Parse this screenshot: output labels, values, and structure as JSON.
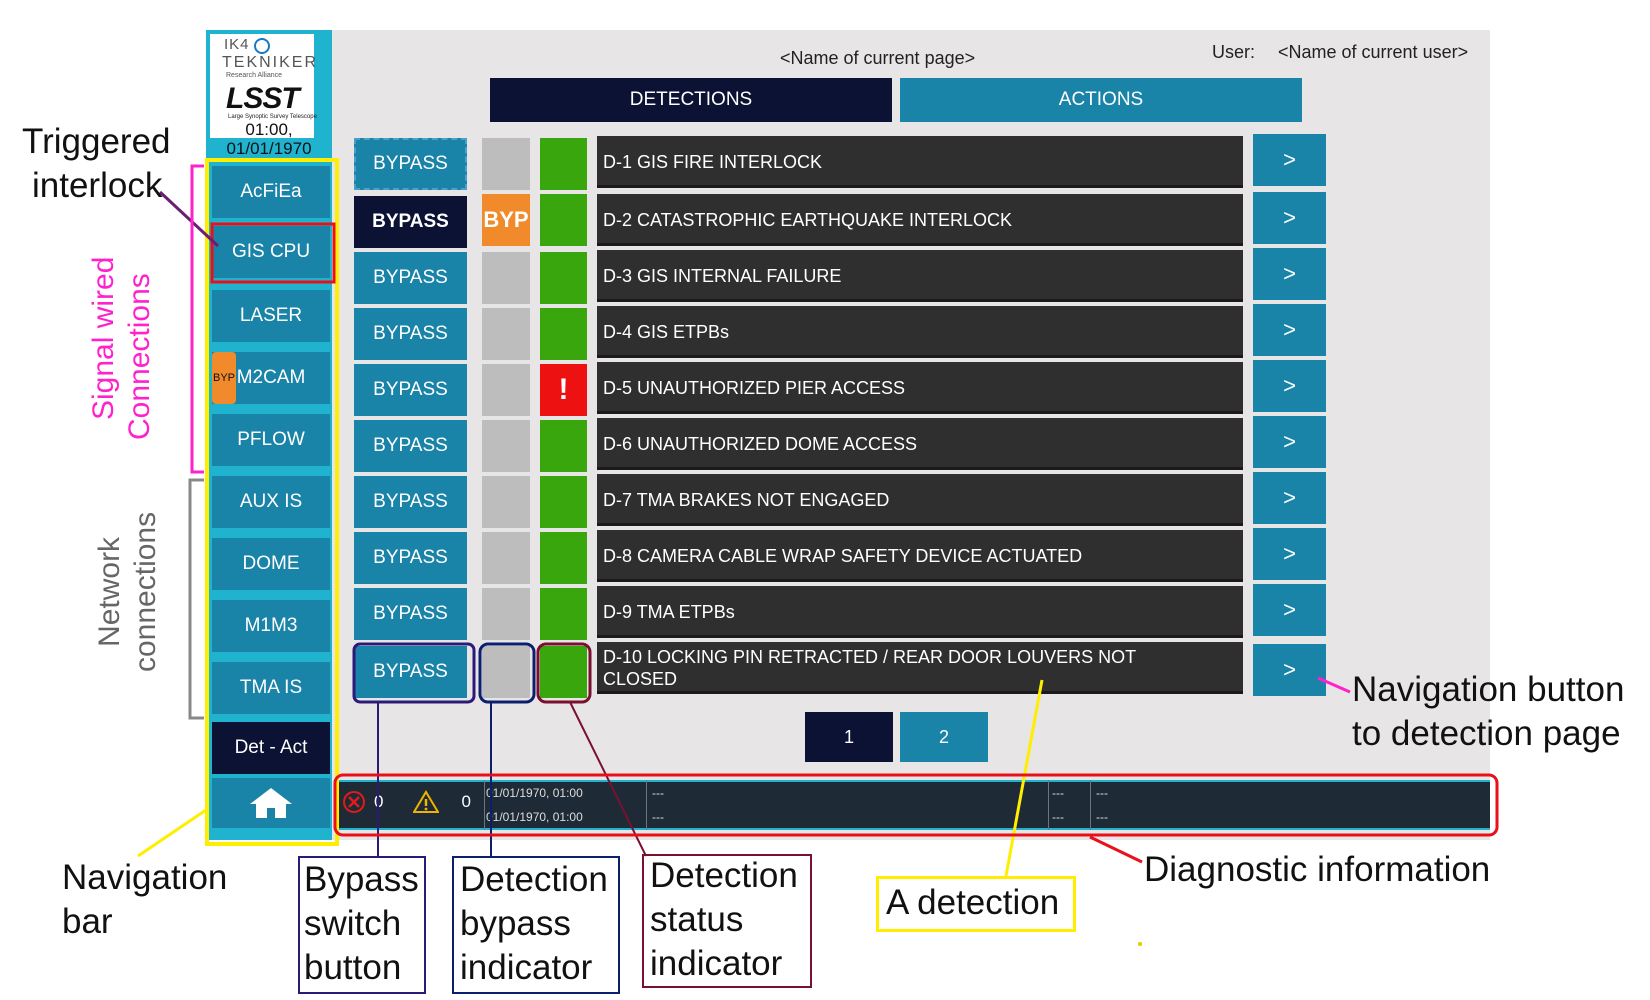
{
  "app": {
    "logo": {
      "org_top": "IK4",
      "org_name": "TEKNIKER",
      "org_sub": "Research Alliance",
      "project": "LSST",
      "project_sub": "Large Synoptic Survey Telescope"
    },
    "clock_line1": "01:00,",
    "clock_line2": "01/01/1970",
    "header": {
      "page_name": "<Name of current page>",
      "user_label": "User:",
      "user_name": "<Name of current user>"
    },
    "tabs": [
      {
        "label": "DETECTIONS",
        "active": true
      },
      {
        "label": "ACTIONS",
        "active": false
      }
    ],
    "sidebar": {
      "items": [
        {
          "label": "AcFiEa"
        },
        {
          "label": "GIS CPU",
          "triggered": true
        },
        {
          "label": "LASER"
        },
        {
          "label": "M2CAM",
          "badge": "BYP"
        },
        {
          "label": "PFLOW"
        },
        {
          "label": "AUX IS"
        },
        {
          "label": "DOME"
        },
        {
          "label": "M1M3"
        },
        {
          "label": "TMA IS"
        },
        {
          "label": "Det - Act",
          "selected": true
        }
      ],
      "home_icon": "home-icon"
    },
    "detections": [
      {
        "bypass_label": "BYPASS",
        "bypass_active": false,
        "bypass_indicator": "",
        "status": "ok",
        "text": "D-1 GIS FIRE INTERLOCK",
        "nav": ">"
      },
      {
        "bypass_label": "BYPASS",
        "bypass_active": true,
        "bypass_indicator": "BYP",
        "status": "ok",
        "text": "D-2 CATASTROPHIC EARTHQUAKE INTERLOCK",
        "nav": ">"
      },
      {
        "bypass_label": "BYPASS",
        "bypass_active": false,
        "bypass_indicator": "",
        "status": "ok",
        "text": "D-3 GIS INTERNAL FAILURE",
        "nav": ">"
      },
      {
        "bypass_label": "BYPASS",
        "bypass_active": false,
        "bypass_indicator": "",
        "status": "ok",
        "text": "D-4 GIS ETPBs",
        "nav": ">"
      },
      {
        "bypass_label": "BYPASS",
        "bypass_active": false,
        "bypass_indicator": "",
        "status": "alarm",
        "status_symbol": "!",
        "text": "D-5 UNAUTHORIZED PIER ACCESS",
        "nav": ">"
      },
      {
        "bypass_label": "BYPASS",
        "bypass_active": false,
        "bypass_indicator": "",
        "status": "ok",
        "text": "D-6 UNAUTHORIZED DOME ACCESS",
        "nav": ">"
      },
      {
        "bypass_label": "BYPASS",
        "bypass_active": false,
        "bypass_indicator": "",
        "status": "ok",
        "text": "D-7 TMA BRAKES NOT ENGAGED",
        "nav": ">"
      },
      {
        "bypass_label": "BYPASS",
        "bypass_active": false,
        "bypass_indicator": "",
        "status": "ok",
        "text": "D-8 CAMERA CABLE WRAP SAFETY DEVICE ACTUATED",
        "nav": ">"
      },
      {
        "bypass_label": "BYPASS",
        "bypass_active": false,
        "bypass_indicator": "",
        "status": "ok",
        "text": "D-9 TMA ETPBs",
        "nav": ">"
      },
      {
        "bypass_label": "BYPASS",
        "bypass_active": false,
        "bypass_indicator": "",
        "status": "ok",
        "text_line1": "D-10 LOCKING PIN RETRACTED / REAR DOOR LOUVERS NOT",
        "text_line2": "CLOSED",
        "nav": ">"
      }
    ],
    "pagination": [
      {
        "label": "1",
        "active": true
      },
      {
        "label": "2",
        "active": false
      }
    ],
    "diagnostics": {
      "error_count": "0",
      "warning_count": "0",
      "row1_time": "01/01/1970, 01:00",
      "row2_time": "01/01/1970, 01:00",
      "row1_msg": "---",
      "row2_msg": "---",
      "row1_col3": "---",
      "row2_col3": "---",
      "row1_col4": "---",
      "row2_col4": "---"
    }
  },
  "annotations": {
    "triggered_interlock_1": "Triggered",
    "triggered_interlock_2": "interlock",
    "signal_wired_1": "Signal wired",
    "signal_wired_2": "Connections",
    "network_1": "Network",
    "network_2": "connections",
    "navigation_bar_1": "Navigation",
    "navigation_bar_2": "bar",
    "bypass_switch_1": "Bypass",
    "bypass_switch_2": "switch",
    "bypass_switch_3": "button",
    "det_bypass_1": "Detection",
    "det_bypass_2": "bypass",
    "det_bypass_3": "indicator",
    "det_status_1": "Detection",
    "det_status_2": "status",
    "det_status_3": "indicator",
    "a_detection": "A detection",
    "diagnostic_info": "Diagnostic information",
    "nav_button_1": "Navigation button",
    "nav_button_2": "to detection page"
  },
  "colors": {
    "sidebar": "#1fb3cf",
    "button": "#1983a8",
    "dark_button": "#0b1233",
    "ok": "#3aa60e",
    "alarm": "#ee1111",
    "bypass": "#f08a2a",
    "annotation_yellow": "#ffee00",
    "annotation_magenta": "#ff22cc",
    "annotation_red": "#e8101a"
  }
}
